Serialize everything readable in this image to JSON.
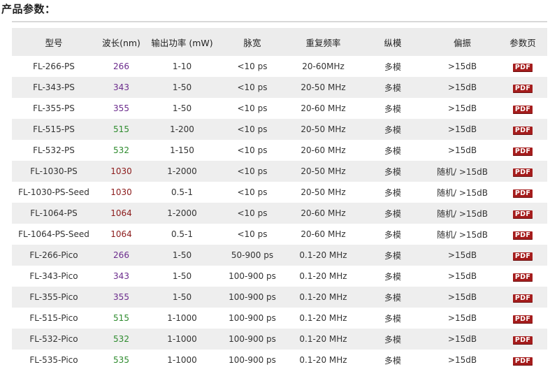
{
  "heading": "产品参数：",
  "columns": [
    "型号",
    "波长(nm)",
    "输出功率 (mW)",
    "脉宽",
    "重复频率",
    "纵模",
    "偏振",
    "参数页"
  ],
  "wavelength_colors": {
    "266": "#6b2b8c",
    "343": "#6b2b8c",
    "355": "#6b2b8c",
    "515": "#2e8b2e",
    "532": "#2e8b2e",
    "535": "#2e8b2e",
    "1030": "#8b1a1a",
    "1064": "#8b1a1a"
  },
  "pdf_label": "PDF",
  "pdf_color": "#a51d1d",
  "rows": [
    {
      "model": "FL-266-PS",
      "wavelength": "266",
      "power": "1-10",
      "pulse": "<10 ps",
      "rep": "20-60MHz",
      "mode": "多模",
      "pol": ">15dB"
    },
    {
      "model": "FL-343-PS",
      "wavelength": "343",
      "power": "1-50",
      "pulse": "<10 ps",
      "rep": "20-50 MHz",
      "mode": "多模",
      "pol": ">15dB"
    },
    {
      "model": "FL-355-PS",
      "wavelength": "355",
      "power": "1-50",
      "pulse": "<10 ps",
      "rep": "20-60 MHz",
      "mode": "多模",
      "pol": ">15dB"
    },
    {
      "model": "FL-515-PS",
      "wavelength": "515",
      "power": "1-200",
      "pulse": "<10 ps",
      "rep": "20-50 MHz",
      "mode": "多模",
      "pol": ">15dB"
    },
    {
      "model": "FL-532-PS",
      "wavelength": "532",
      "power": "1-150",
      "pulse": "<10 ps",
      "rep": "20-60 MHz",
      "mode": "多模",
      "pol": ">15dB"
    },
    {
      "model": "FL-1030-PS",
      "wavelength": "1030",
      "power": "1-2000",
      "pulse": "<10 ps",
      "rep": "20-50 MHz",
      "mode": "多模",
      "pol": "随机/ >15dB"
    },
    {
      "model": "FL-1030-PS-Seed",
      "wavelength": "1030",
      "power": "0.5-1",
      "pulse": "<10 ps",
      "rep": "20-50 MHz",
      "mode": "多模",
      "pol": "随机/ >15dB"
    },
    {
      "model": "FL-1064-PS",
      "wavelength": "1064",
      "power": "1-2000",
      "pulse": "<10 ps",
      "rep": "20-60 MHz",
      "mode": "多模",
      "pol": "随机/ >15dB"
    },
    {
      "model": "FL-1064-PS-Seed",
      "wavelength": "1064",
      "power": "0.5-1",
      "pulse": "<10 ps",
      "rep": "20-60 MHz",
      "mode": "多模",
      "pol": "随机/ >15dB"
    },
    {
      "model": "FL-266-Pico",
      "wavelength": "266",
      "power": "1-50",
      "pulse": "50-900 ps",
      "rep": "0.1-20 MHz",
      "mode": "多模",
      "pol": ">15dB"
    },
    {
      "model": "FL-343-Pico",
      "wavelength": "343",
      "power": "1-50",
      "pulse": "100-900 ps",
      "rep": "0.1-20 MHz",
      "mode": "多模",
      "pol": ">15dB"
    },
    {
      "model": "FL-355-Pico",
      "wavelength": "355",
      "power": "1-50",
      "pulse": "100-900 ps",
      "rep": "0.1-20 MHz",
      "mode": "多模",
      "pol": ">15dB"
    },
    {
      "model": "FL-515-Pico",
      "wavelength": "515",
      "power": "1-1000",
      "pulse": "100-900 ps",
      "rep": "0.1-20 MHz",
      "mode": "多模",
      "pol": ">15dB"
    },
    {
      "model": "FL-532-Pico",
      "wavelength": "532",
      "power": "1-1000",
      "pulse": "100-900 ps",
      "rep": "0.1-20 MHz",
      "mode": "多模",
      "pol": ">15dB"
    },
    {
      "model": "FL-535-Pico",
      "wavelength": "535",
      "power": "1-1000",
      "pulse": "100-900 ps",
      "rep": "0.1-20 MHz",
      "mode": "多模",
      "pol": ">15dB"
    }
  ]
}
